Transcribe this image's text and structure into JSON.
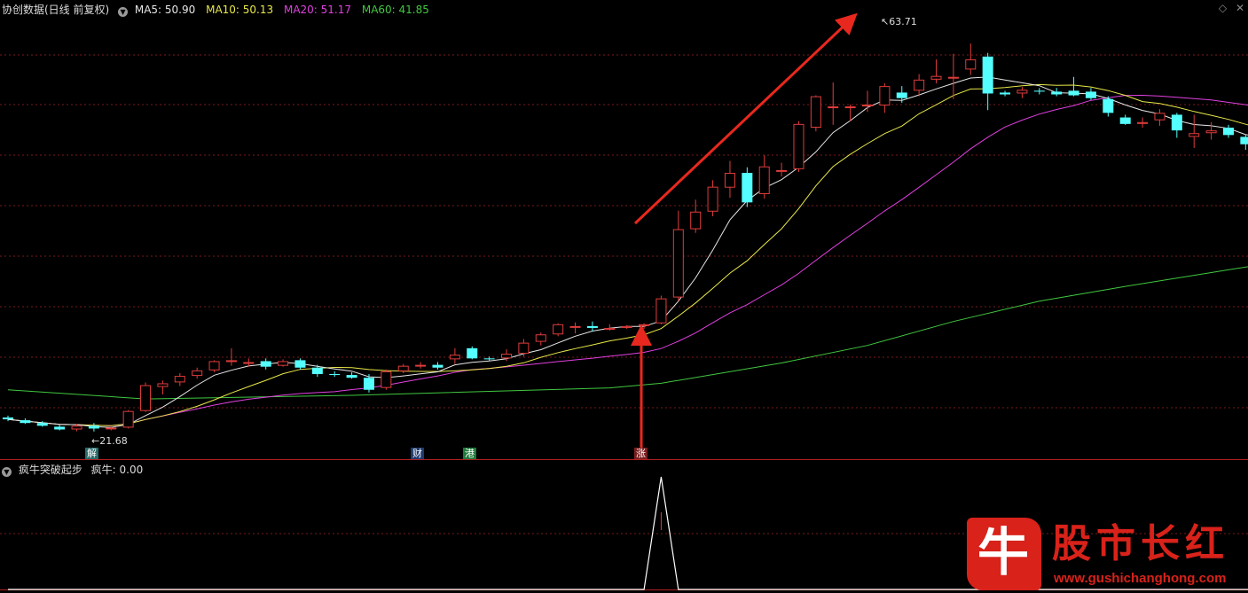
{
  "header": {
    "title": "协创数据(日线 前复权)",
    "ma": [
      {
        "label": "MA5: 50.90",
        "color": "#e6e6e6"
      },
      {
        "label": "MA10: 50.13",
        "color": "#e8e84a"
      },
      {
        "label": "MA20: 51.17",
        "color": "#e040e0"
      },
      {
        "label": "MA60: 41.85",
        "color": "#40c840"
      }
    ]
  },
  "indicator": {
    "title": "疯牛突破起步",
    "value_label": "疯牛: 0.00"
  },
  "annotations": {
    "high_label": "63.71",
    "low_label": "21.68",
    "tags": [
      {
        "text": "解",
        "bg": "#2a6a6a",
        "color": "#fff"
      },
      {
        "text": "财",
        "bg": "#1e3a6e",
        "color": "#fff"
      },
      {
        "text": "港",
        "bg": "#1e7a3a",
        "color": "#fff"
      },
      {
        "text": "涨",
        "bg": "#7a1e1e",
        "color": "#fff"
      }
    ]
  },
  "watermark": {
    "logo_char": "牛",
    "name": "股市长红",
    "url": "www.gushichanghong.com"
  },
  "colors": {
    "up": "#e03c3c",
    "down": "#54ffff",
    "ma5": "#e6e6e6",
    "ma10": "#e8e84a",
    "ma20": "#e040e0",
    "ma60": "#40c840",
    "grid": "#7a1a1a",
    "arrow": "#e8281e"
  },
  "chart_data": {
    "type": "candlestick",
    "candles": [
      [
        23.2,
        23.4,
        22.8,
        23.0
      ],
      [
        22.9,
        23.1,
        22.5,
        22.6
      ],
      [
        22.6,
        22.8,
        22.2,
        22.3
      ],
      [
        22.2,
        22.4,
        21.8,
        21.9
      ],
      [
        21.9,
        22.5,
        21.7,
        22.3
      ],
      [
        22.3,
        22.6,
        21.68,
        22.0
      ],
      [
        22.0,
        22.3,
        21.8,
        22.1
      ],
      [
        22.1,
        24.0,
        22.0,
        23.9
      ],
      [
        23.9,
        27.0,
        23.8,
        26.7
      ],
      [
        26.5,
        27.2,
        25.7,
        26.9
      ],
      [
        27.0,
        28.0,
        26.6,
        27.7
      ],
      [
        27.7,
        28.6,
        27.4,
        28.3
      ],
      [
        28.3,
        29.4,
        28.1,
        29.3
      ],
      [
        29.3,
        30.7,
        28.8,
        29.4
      ],
      [
        29.2,
        29.6,
        28.7,
        29.2
      ],
      [
        29.3,
        29.6,
        28.4,
        28.7
      ],
      [
        28.8,
        29.5,
        28.7,
        29.3
      ],
      [
        29.4,
        29.6,
        28.4,
        28.6
      ],
      [
        28.6,
        28.9,
        27.6,
        27.9
      ],
      [
        27.9,
        28.2,
        27.6,
        27.8
      ],
      [
        27.8,
        28.1,
        27.4,
        27.5
      ],
      [
        27.5,
        27.9,
        25.9,
        26.2
      ],
      [
        26.4,
        28.4,
        26.2,
        28.2
      ],
      [
        28.2,
        29.0,
        28.0,
        28.8
      ],
      [
        28.8,
        29.2,
        28.5,
        28.9
      ],
      [
        28.9,
        29.2,
        28.4,
        28.6
      ],
      [
        29.5,
        30.7,
        29.0,
        30.0
      ],
      [
        30.7,
        30.9,
        29.5,
        29.6
      ],
      [
        29.6,
        29.8,
        29.3,
        29.5
      ],
      [
        29.6,
        30.6,
        29.3,
        30.1
      ],
      [
        30.1,
        31.7,
        29.8,
        31.3
      ],
      [
        31.4,
        32.4,
        31.0,
        32.2
      ],
      [
        32.2,
        33.4,
        32.0,
        33.3
      ],
      [
        33.0,
        33.5,
        32.3,
        33.1
      ],
      [
        33.1,
        33.6,
        32.5,
        32.9
      ],
      [
        32.8,
        33.3,
        32.6,
        32.9
      ],
      [
        32.9,
        33.2,
        32.8,
        33.1
      ],
      [
        33.1,
        33.4,
        32.8,
        33.3
      ],
      [
        33.4,
        36.4,
        33.3,
        36.1
      ],
      [
        36.2,
        45.6,
        35.8,
        43.6
      ],
      [
        43.6,
        46.8,
        43.2,
        45.5
      ],
      [
        45.5,
        48.9,
        45.0,
        48.2
      ],
      [
        48.1,
        51.0,
        47.0,
        49.7
      ],
      [
        49.7,
        50.3,
        46.0,
        46.5
      ],
      [
        47.4,
        51.6,
        46.9,
        50.4
      ],
      [
        49.9,
        50.8,
        49.3,
        50.0
      ],
      [
        50.1,
        55.3,
        49.8,
        55.0
      ],
      [
        54.6,
        58.1,
        54.2,
        58.0
      ],
      [
        56.8,
        59.5,
        54.9,
        56.9
      ],
      [
        56.9,
        57.1,
        55.3,
        56.9
      ],
      [
        56.9,
        58.6,
        56.3,
        57.1
      ],
      [
        57.0,
        59.4,
        56.2,
        59.1
      ],
      [
        58.4,
        59.1,
        57.3,
        57.8
      ],
      [
        58.6,
        60.4,
        58.0,
        59.8
      ],
      [
        59.8,
        62.0,
        59.4,
        60.2
      ],
      [
        60.0,
        62.6,
        57.7,
        60.1
      ],
      [
        60.9,
        63.71,
        60.3,
        62.0
      ],
      [
        62.3,
        62.7,
        56.5,
        58.3
      ],
      [
        58.4,
        58.6,
        58.0,
        58.2
      ],
      [
        58.3,
        59.0,
        57.8,
        58.7
      ],
      [
        58.6,
        58.9,
        58.2,
        58.5
      ],
      [
        58.5,
        58.9,
        58.0,
        58.2
      ],
      [
        58.6,
        60.1,
        58.0,
        58.1
      ],
      [
        58.5,
        58.9,
        57.6,
        57.8
      ],
      [
        57.7,
        58.0,
        55.8,
        56.2
      ],
      [
        55.7,
        56.0,
        54.9,
        55.0
      ],
      [
        55.0,
        55.7,
        54.6,
        55.2
      ],
      [
        55.4,
        56.6,
        54.8,
        56.2
      ],
      [
        56.0,
        56.2,
        53.5,
        54.3
      ],
      [
        53.6,
        56.0,
        52.4,
        54.0
      ],
      [
        54.0,
        55.2,
        53.3,
        54.3
      ],
      [
        54.6,
        54.9,
        53.5,
        53.8
      ],
      [
        53.6,
        53.8,
        52.2,
        52.8
      ],
      [
        52.3,
        52.5,
        51.9,
        53.0
      ],
      [
        52.7,
        56.2,
        51.5,
        56.3
      ],
      [
        56.1,
        56.6,
        54.7,
        55.0
      ],
      [
        55.6,
        58.3,
        55.0,
        57.0
      ],
      [
        56.9,
        57.3,
        55.6,
        55.8
      ],
      [
        56.1,
        56.3,
        54.3,
        54.8
      ],
      [
        55.4,
        55.6,
        54.5,
        54.9
      ],
      [
        55.8,
        56.1,
        54.9,
        55.2
      ]
    ],
    "ma60": [
      [
        0,
        26.2
      ],
      [
        8,
        25.2
      ],
      [
        20,
        25.6
      ],
      [
        35,
        26.4
      ],
      [
        38,
        26.9
      ],
      [
        45,
        29.1
      ],
      [
        50,
        31.0
      ],
      [
        55,
        33.6
      ],
      [
        60,
        35.8
      ],
      [
        65,
        37.4
      ],
      [
        70,
        38.9
      ],
      [
        75,
        40.4
      ],
      [
        80,
        42.0
      ]
    ],
    "ylim": [
      20.7,
      66.7
    ],
    "indicator_series": [
      [
        0,
        0
      ],
      [
        37,
        0
      ],
      [
        38,
        1
      ],
      [
        39,
        0
      ],
      [
        80,
        0
      ]
    ],
    "indicator_ylim": [
      0,
      1
    ]
  }
}
